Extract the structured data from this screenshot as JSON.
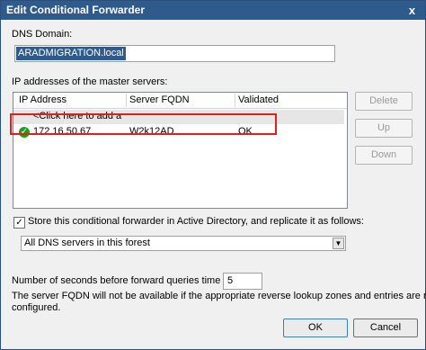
{
  "window": {
    "title": "Edit Conditional Forwarder",
    "close_glyph": "x"
  },
  "dns_domain": {
    "label": "DNS Domain:",
    "value": "ARADMIGRATION.local"
  },
  "master_servers": {
    "label": "IP addresses of the master servers:",
    "columns": [
      "IP Address",
      "Server FQDN",
      "Validated"
    ],
    "add_placeholder": "<Click here to add a",
    "rows": [
      {
        "ip": "172.16.50.67",
        "fqdn": "W2k12AD",
        "validated": "OK",
        "status_icon": "check-icon"
      }
    ]
  },
  "side_buttons": {
    "delete": "Delete",
    "up": "Up",
    "down": "Down"
  },
  "store_ad": {
    "checked": true,
    "label": "Store this conditional forwarder in Active Directory, and replicate it as follows:",
    "replication": "All DNS servers in this forest"
  },
  "timeout": {
    "label": "Number of seconds before forward queries time out:",
    "value": "5",
    "note_line1": "The server FQDN will not be available if the appropriate reverse lookup zones and entries are not",
    "note_line2": "configured."
  },
  "footer": {
    "ok": "OK",
    "cancel": "Cancel"
  },
  "colors": {
    "titlebar": "#2f5b8c",
    "highlight_box": "#e0201c",
    "ok_icon": "#1aa11a"
  }
}
